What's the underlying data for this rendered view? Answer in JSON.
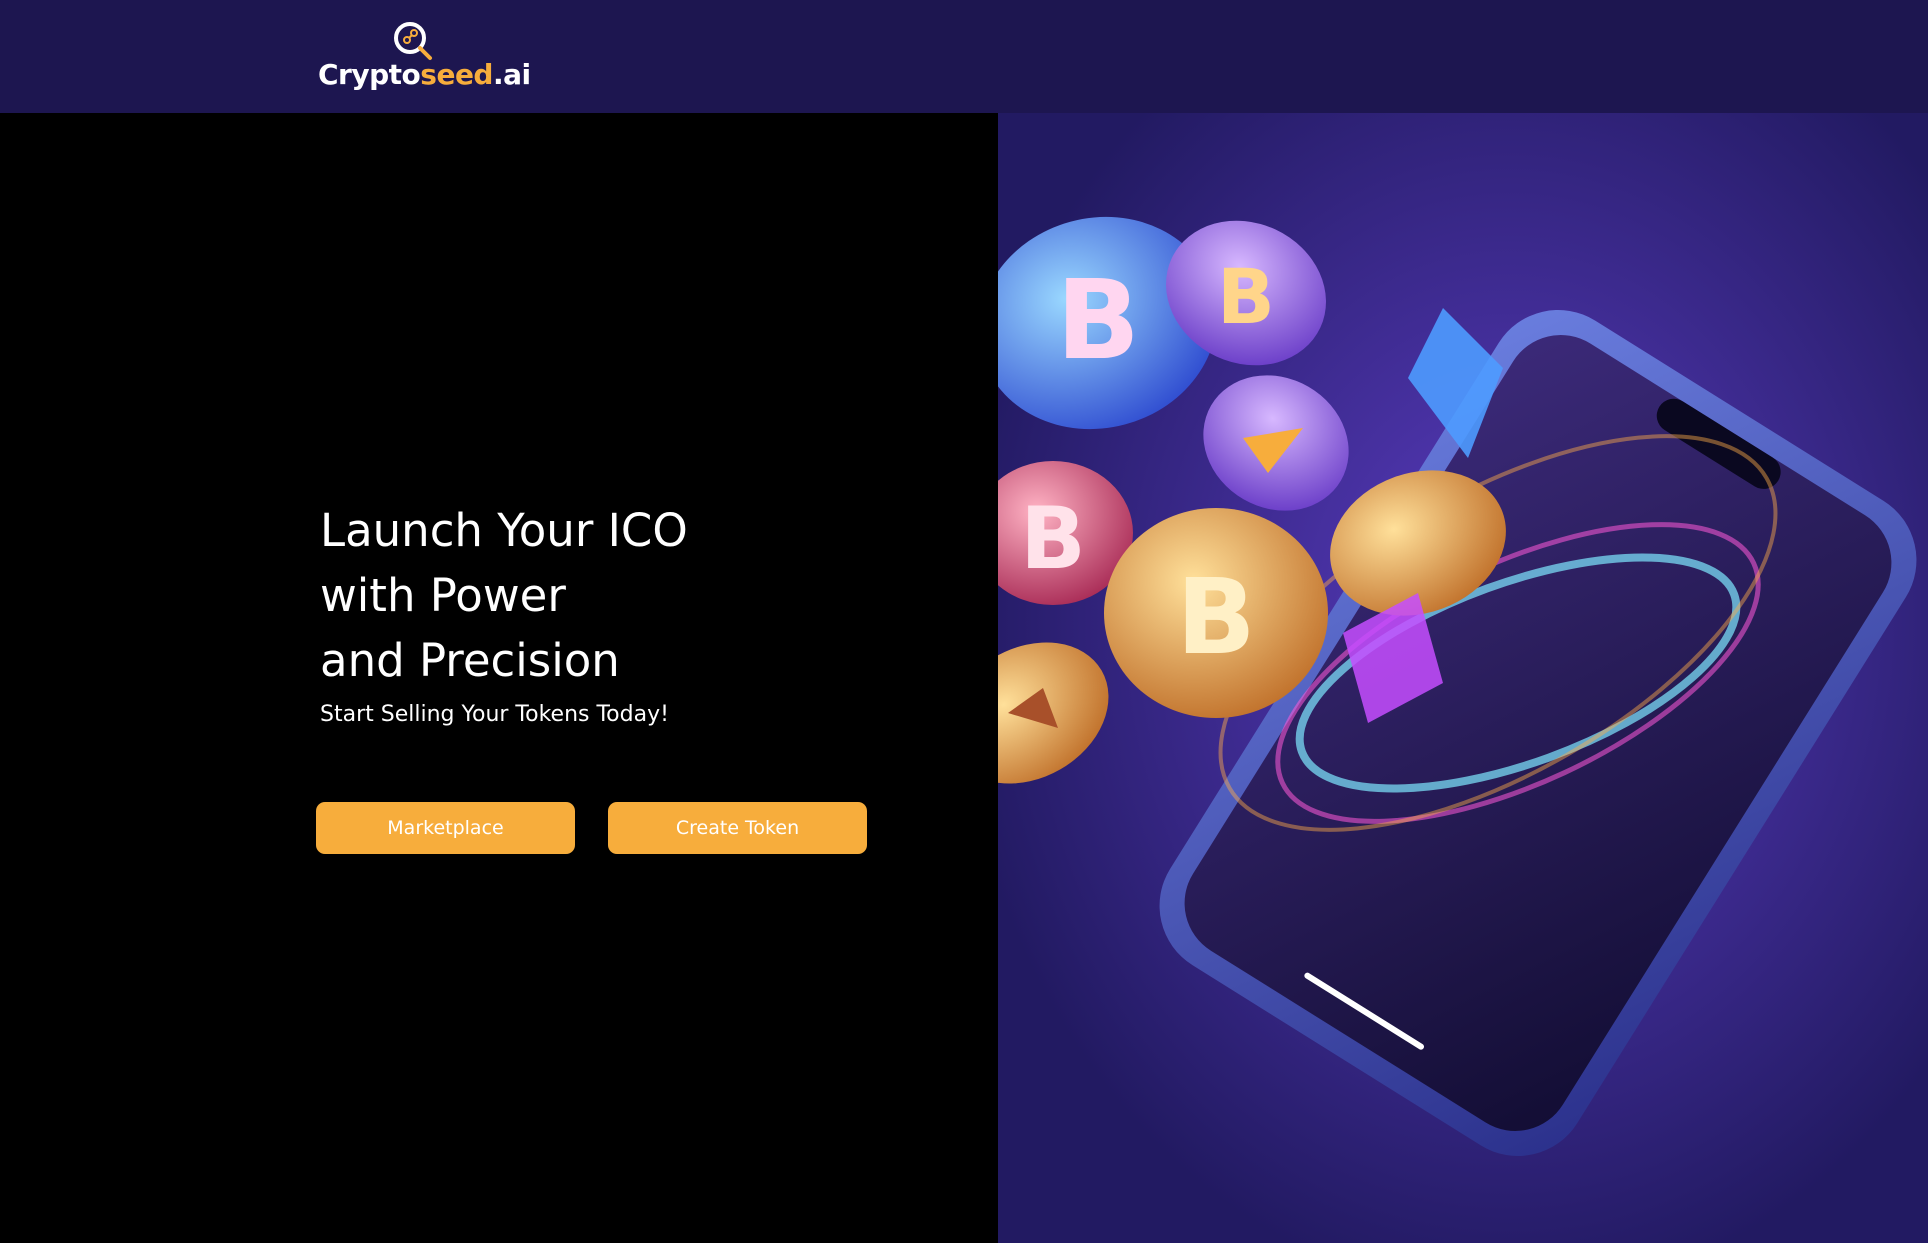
{
  "brand": {
    "name_main": "Crypto",
    "name_accent": "seed",
    "name_suffix": ".ai",
    "logo_icon": "seed-magnifier-logo-icon"
  },
  "hero": {
    "headline_lines": [
      "Launch Your ICO",
      "with Power",
      "and Precision"
    ],
    "subheadline": "Start Selling Your Tokens Today!",
    "buttons": {
      "marketplace": "Marketplace",
      "create_token": "Create Token"
    },
    "illustration": "smartphone-with-floating-crypto-coins-image"
  },
  "colors": {
    "header_bg": "#1d1650",
    "hero_left_bg": "#000000",
    "hero_right_bg": "#221a62",
    "accent": "#f7ad3c",
    "text": "#ffffff"
  }
}
